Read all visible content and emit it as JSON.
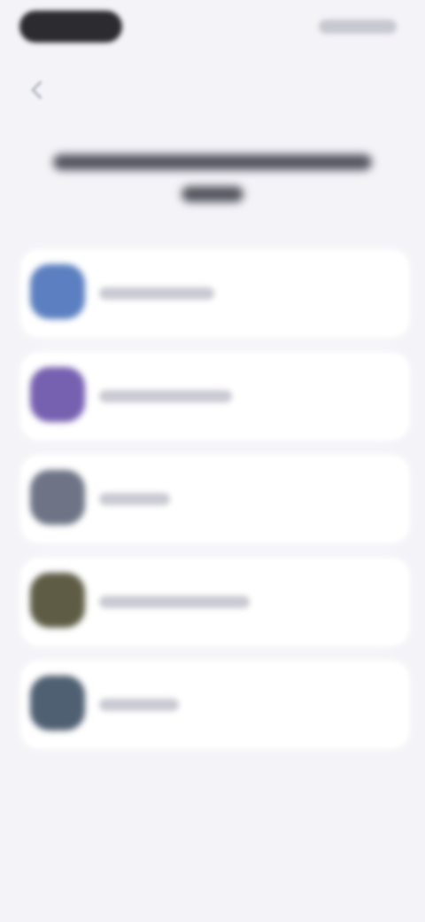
{
  "title": "",
  "options": [
    {
      "label": "",
      "icon": "blue-square-icon",
      "color": "#5b7fc0"
    },
    {
      "label": "",
      "icon": "purple-square-icon",
      "color": "#7660b0"
    },
    {
      "label": "",
      "icon": "gray-square-icon",
      "color": "#6e7486"
    },
    {
      "label": "",
      "icon": "olive-square-icon",
      "color": "#5e5c44"
    },
    {
      "label": "",
      "icon": "slate-square-icon",
      "color": "#4f6072"
    }
  ]
}
